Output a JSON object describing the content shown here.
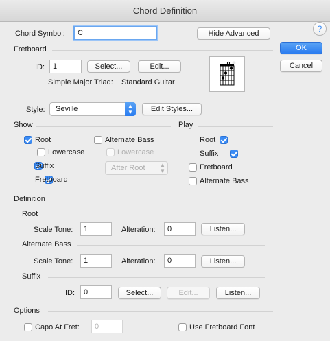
{
  "window": {
    "title": "Chord Definition"
  },
  "chord_symbol": {
    "label": "Chord Symbol:",
    "value": "C"
  },
  "buttons": {
    "hide_advanced": "Hide Advanced",
    "ok": "OK",
    "cancel": "Cancel",
    "help": "?"
  },
  "fretboard": {
    "section": "Fretboard",
    "id_label": "ID:",
    "id_value": "1",
    "select": "Select...",
    "edit": "Edit...",
    "name": "Simple Major Triad:",
    "instrument": "Standard Guitar"
  },
  "style": {
    "label": "Style:",
    "value": "Seville",
    "edit_styles": "Edit Styles..."
  },
  "show": {
    "section": "Show",
    "root": "Root",
    "lowercase": "Lowercase",
    "suffix": "Suffix",
    "fretboard": "Fretboard",
    "alternate_bass": "Alternate Bass",
    "alt_lowercase": "Lowercase",
    "position": "After Root"
  },
  "play": {
    "section": "Play",
    "root": "Root",
    "suffix": "Suffix",
    "fretboard": "Fretboard",
    "alternate_bass": "Alternate Bass"
  },
  "definition": {
    "section": "Definition",
    "root": {
      "section": "Root",
      "scale_tone_label": "Scale Tone:",
      "scale_tone_value": "1",
      "alteration_label": "Alteration:",
      "alteration_value": "0",
      "listen": "Listen..."
    },
    "alternate_bass": {
      "section": "Alternate Bass",
      "scale_tone_label": "Scale Tone:",
      "scale_tone_value": "1",
      "alteration_label": "Alteration:",
      "alteration_value": "0",
      "listen": "Listen..."
    },
    "suffix": {
      "section": "Suffix",
      "id_label": "ID:",
      "id_value": "0",
      "select": "Select...",
      "edit": "Edit...",
      "listen": "Listen..."
    }
  },
  "options": {
    "section": "Options",
    "capo_label": "Capo At Fret:",
    "capo_value": "0",
    "use_fretboard_font": "Use Fretboard Font"
  },
  "colors": {
    "accent": "#3b8cf5",
    "background": "#ececec"
  }
}
